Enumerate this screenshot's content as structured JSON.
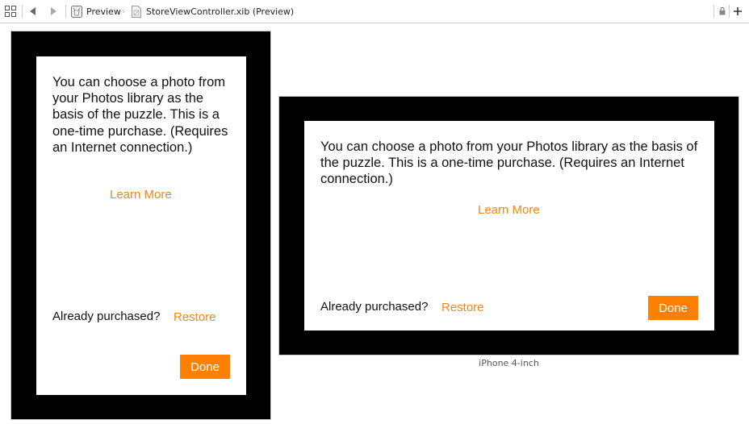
{
  "jumpbar": {
    "icons": [
      "related-items-grid-icon",
      "back-arrow-icon",
      "forward-arrow-icon",
      "preview-icon",
      "xib-file-icon",
      "lock-icon",
      "add-icon"
    ],
    "crumbs": [
      "Preview",
      "StoreViewController.xib (Preview)"
    ],
    "separator_glyph": "›"
  },
  "colors": {
    "accent": "#ff7f00",
    "link": "#f0861a",
    "device_bezel": "#000000"
  },
  "previews": [
    {
      "orientation": "portrait",
      "description": "You can choose a photo from your Photos library as the basis of the puzzle. This is a one-time purchase. (Requires an Internet connection.)",
      "learn_more": "Learn More",
      "already_purchased": "Already purchased?",
      "restore": "Restore",
      "done": "Done"
    },
    {
      "orientation": "landscape",
      "description": "You can choose a photo from your Photos library as the basis of the puzzle. This is a one-time purchase. (Requires an Internet connection.)",
      "learn_more": "Learn More",
      "already_purchased": "Already purchased?",
      "restore": "Restore",
      "done": "Done",
      "device_label": "iPhone 4-inch"
    }
  ]
}
